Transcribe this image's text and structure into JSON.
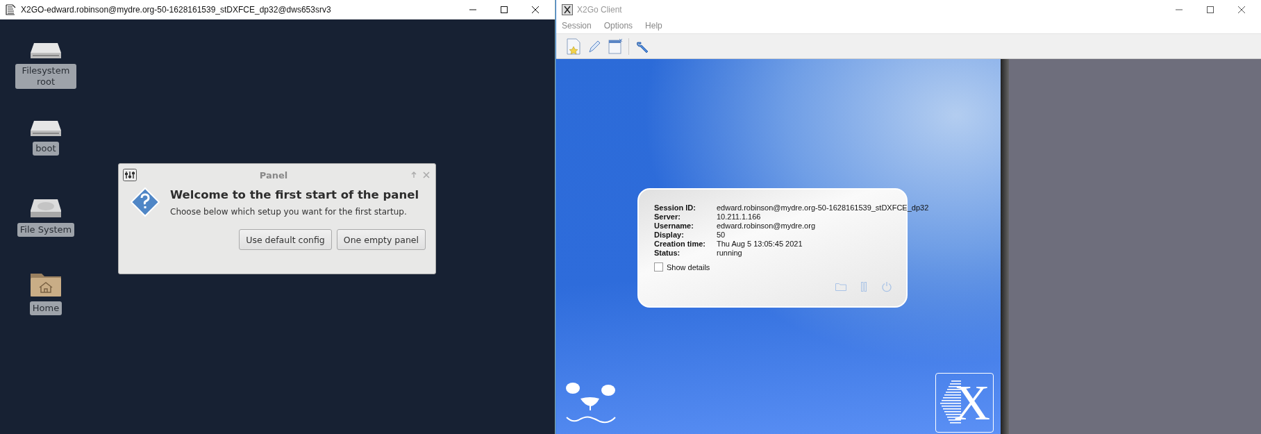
{
  "left_window": {
    "title": "X2GO-edward.robinson@mydre.org-50-1628161539_stDXFCE_dp32@dws653srv3",
    "desktop_icons": [
      {
        "label": "Filesystem root",
        "kind": "drive"
      },
      {
        "label": "boot",
        "kind": "drive"
      },
      {
        "label": "File System",
        "kind": "disk"
      },
      {
        "label": "Home",
        "kind": "folder"
      }
    ],
    "dialog": {
      "title": "Panel",
      "heading": "Welcome to the first start of the panel",
      "message": "Choose below which setup you want for the first startup.",
      "buttons": [
        "Use default config",
        "One empty panel"
      ]
    }
  },
  "right_window": {
    "title": "X2Go Client",
    "menu": [
      "Session",
      "Options",
      "Help"
    ],
    "session": {
      "fields": [
        {
          "label": "Session ID:",
          "value": "edward.robinson@mydre.org-50-1628161539_stDXFCE_dp32"
        },
        {
          "label": "Server:",
          "value": "10.211.1.166"
        },
        {
          "label": "Username:",
          "value": "edward.robinson@mydre.org"
        },
        {
          "label": "Display:",
          "value": "50"
        },
        {
          "label": "Creation time:",
          "value": "Thu Aug 5 13:05:45 2021"
        },
        {
          "label": "Status:",
          "value": "running"
        }
      ],
      "show_details": {
        "label": "Show details",
        "checked": false
      }
    },
    "logo_text": "X"
  }
}
